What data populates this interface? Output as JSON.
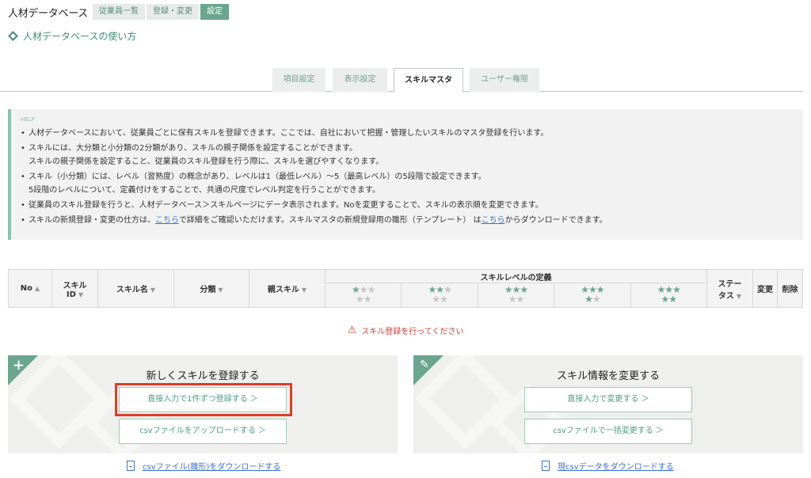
{
  "header": {
    "app_title": "人材データベース",
    "nav": [
      {
        "label": "従業員一覧",
        "active": false
      },
      {
        "label": "登録・変更",
        "active": false
      },
      {
        "label": "設定",
        "active": true
      }
    ]
  },
  "howto_link": "人材データベースの使い方",
  "tabs": [
    {
      "label": "項目設定",
      "active": false
    },
    {
      "label": "表示設定",
      "active": false
    },
    {
      "label": "スキルマスタ",
      "active": true
    },
    {
      "label": "ユーザー権限",
      "active": false
    }
  ],
  "help": {
    "tag": "HELP",
    "items": [
      {
        "text": "人材データベースにおいて、従業員ごとに保有スキルを登録できます。ここでは、自社において把握・管理したいスキルのマスタ登録を行います。"
      },
      {
        "text": "スキルには、大分類と小分類の2分類があり、スキルの親子関係を設定することができます。",
        "sub": "スキルの親子関係を設定すること、従業員のスキル登録を行う際に、スキルを選びやすくなります。"
      },
      {
        "text": "スキル（小分類）には、レベル（習熟度）の概念があり、レベルは1（最低レベル）〜5（最高レベル）の5段階で設定できます。",
        "sub": "5段階のレベルについて、定義付けをすることで、共通の尺度でレベル判定を行うことができます。"
      },
      {
        "text": "従業員のスキル登録を行うと、人材データベース＞スキルページにデータ表示されます。Noを変更することで、スキルの表示順を変更できます。"
      }
    ],
    "last_item": {
      "part1": "スキルの新規登録・変更の仕方は、",
      "link1": "こちら",
      "part2": "で詳細をご確認いただけます。スキルマスタの新規登録用の雛形（テンプレート） は",
      "link2": "こちら",
      "part3": "からダウンロードできます。"
    }
  },
  "table": {
    "headers": {
      "no": "No",
      "skill_id_line1": "スキル",
      "skill_id_line2": "ID",
      "skill_name": "スキル名",
      "category": "分類",
      "parent_skill": "親スキル",
      "level_definition": "スキルレベルの定義",
      "status_line1": "ステー",
      "status_line2": "タス",
      "edit": "変更",
      "delete": "削除"
    },
    "sort_arrows": {
      "up": "▲",
      "down": "▼"
    },
    "levels": [
      1,
      2,
      3,
      4,
      5
    ]
  },
  "warning": "スキル登録を行ってください",
  "panel_new": {
    "corner_icon": "+",
    "title": "新しくスキルを登録する",
    "btn_direct": "直接入力で1件ずつ登録する ＞",
    "btn_csv": "csvファイルをアップロードする ＞",
    "download_link": "csvファイル(雛形)をダウンロードする"
  },
  "panel_edit": {
    "corner_icon": "✎",
    "title": "スキル情報を変更する",
    "btn_direct": "直接入力で変更する ＞",
    "btn_csv": "csvファイルで一括変更する ＞",
    "download_link": "現csvデータをダウンロードする"
  },
  "colors": {
    "accent": "#6aa68f",
    "warning": "#d63a3a",
    "highlight": "#e23b26",
    "link": "#3a6fd8"
  }
}
